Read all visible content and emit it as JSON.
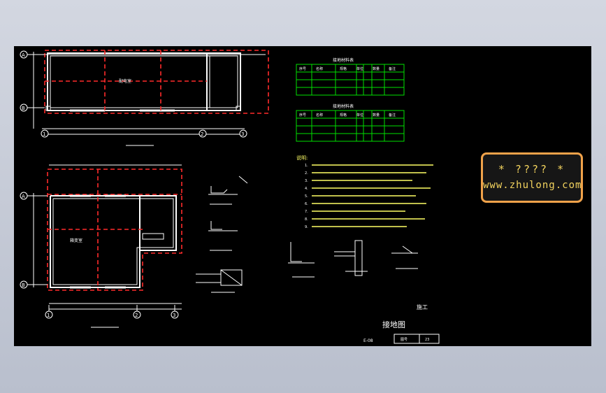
{
  "colors": {
    "background": "#c6cad6",
    "canvas": "#000000",
    "wall": "#ffffff",
    "grounding_line": "#ff2a2a",
    "table_border": "#00e000",
    "watermark_border": "#f0a24a",
    "watermark_text": "#f3d35e"
  },
  "plan_top": {
    "axis_labels": [
      "A",
      "B",
      "1",
      "2",
      "3"
    ],
    "room_label": "配电室"
  },
  "plan_bottom": {
    "axis_labels": [
      "A",
      "B",
      "1",
      "2",
      "3"
    ],
    "room_label": "箱变室"
  },
  "tables": {
    "headers": [
      "序号",
      "名称",
      "规格",
      "单位",
      "数量",
      "备注"
    ],
    "table1_title": "接地材料表",
    "table2_title": "接地材料表"
  },
  "notes": {
    "heading": "说明:",
    "items": [
      "1.",
      "2.",
      "3.",
      "4.",
      "5.",
      "6.",
      "7.",
      "8.",
      "9."
    ]
  },
  "title_block": {
    "stage": "施工",
    "drawing_title": "接地图",
    "number": "E-08",
    "field_1": "图号",
    "field_2": "23"
  },
  "watermark": {
    "line1": "*  ????  *",
    "line2": "www.zhulong.com"
  }
}
